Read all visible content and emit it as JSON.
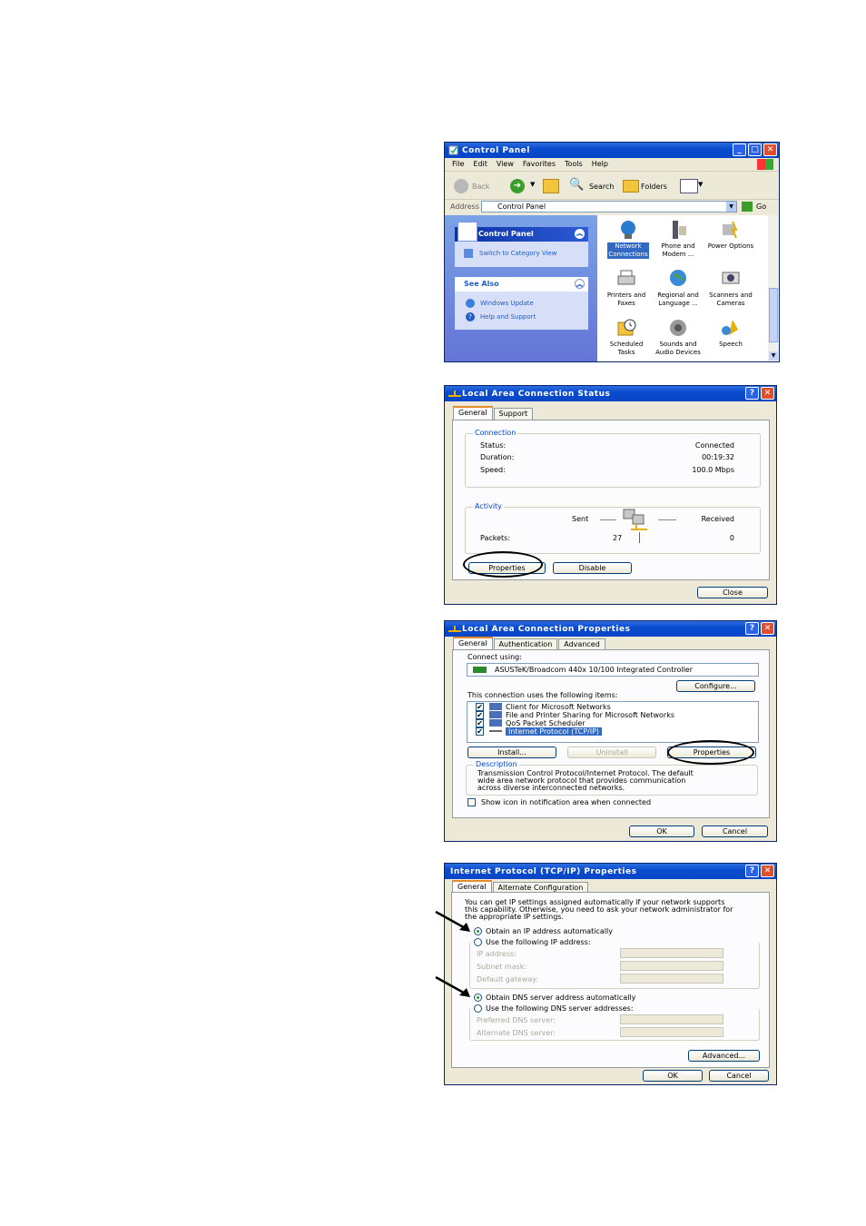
{
  "control_panel": {
    "title": "Control Panel",
    "menu": [
      "File",
      "Edit",
      "View",
      "Favorites",
      "Tools",
      "Help"
    ],
    "toolbar": {
      "back": "Back",
      "search": "Search",
      "folders": "Folders"
    },
    "address_label": "Address",
    "address_value": "Control Panel",
    "go_label": "Go",
    "side_panel_title": "Control Panel",
    "switch_view": "Switch to Category View",
    "see_also_title": "See Also",
    "see_also_items": [
      "Windows Update",
      "Help and Support"
    ],
    "icons": [
      {
        "l1": "Network",
        "l2": "Connections",
        "icon": "network-connections-icon"
      },
      {
        "l1": "Phone and",
        "l2": "Modem ...",
        "icon": "phone-modem-icon"
      },
      {
        "l1": "Power Options",
        "l2": "",
        "icon": "power-options-icon"
      },
      {
        "l1": "Printers and",
        "l2": "Faxes",
        "icon": "printers-faxes-icon"
      },
      {
        "l1": "Regional and",
        "l2": "Language ...",
        "icon": "regional-language-icon"
      },
      {
        "l1": "Scanners and",
        "l2": "Cameras",
        "icon": "scanners-cameras-icon"
      },
      {
        "l1": "Scheduled",
        "l2": "Tasks",
        "icon": "scheduled-tasks-icon"
      },
      {
        "l1": "Sounds and",
        "l2": "Audio Devices",
        "icon": "sounds-audio-icon"
      },
      {
        "l1": "Speech",
        "l2": "",
        "icon": "speech-icon"
      }
    ]
  },
  "lan_status": {
    "title": "Local Area Connection Status",
    "tabs": [
      "General",
      "Support"
    ],
    "connection_label": "Connection",
    "status_label": "Status:",
    "status_value": "Connected",
    "duration_label": "Duration:",
    "duration_value": "00:19:32",
    "speed_label": "Speed:",
    "speed_value": "100.0 Mbps",
    "activity_label": "Activity",
    "sent_label": "Sent",
    "received_label": "Received",
    "packets_label": "Packets:",
    "packets_sent": "27",
    "packets_received": "0",
    "properties_btn": "Properties",
    "disable_btn": "Disable",
    "close_btn": "Close"
  },
  "lan_props": {
    "title": "Local Area Connection Properties",
    "tabs": [
      "General",
      "Authentication",
      "Advanced"
    ],
    "connect_using_label": "Connect using:",
    "adapter": "ASUSTeK/Broadcom 440x 10/100 Integrated Controller",
    "configure_btn": "Configure...",
    "items_label": "This connection uses the following items:",
    "items": [
      "Client for Microsoft Networks",
      "File and Printer Sharing for Microsoft Networks",
      "QoS Packet Scheduler",
      "Internet Protocol (TCP/IP)"
    ],
    "install_btn": "Install...",
    "uninstall_btn": "Uninstall",
    "properties_btn": "Properties",
    "description_label": "Description",
    "description_lines": [
      "Transmission Control Protocol/Internet Protocol. The default",
      "wide area network protocol that provides communication",
      "across diverse interconnected networks."
    ],
    "show_icon_label": "Show icon in notification area when connected",
    "ok_btn": "OK",
    "cancel_btn": "Cancel"
  },
  "tcpip": {
    "title": "Internet Protocol (TCP/IP) Properties",
    "tabs": [
      "General",
      "Alternate Configuration"
    ],
    "intro_lines": [
      "You can get IP settings assigned automatically if your network supports",
      "this capability. Otherwise, you need to ask your network administrator for",
      "the appropriate IP settings."
    ],
    "obtain_ip": "Obtain an IP address automatically",
    "use_ip": "Use the following IP address:",
    "ip_address": "IP address:",
    "subnet_mask": "Subnet mask:",
    "default_gateway": "Default gateway:",
    "obtain_dns": "Obtain DNS server address automatically",
    "use_dns": "Use the following DNS server addresses:",
    "preferred_dns": "Preferred DNS server:",
    "alternate_dns": "Alternate DNS server:",
    "advanced_btn": "Advanced...",
    "ok_btn": "OK",
    "cancel_btn": "Cancel"
  },
  "colors": {
    "title_blue": "#0a4ccf",
    "xp_face": "#ece9d8",
    "link_blue": "#0046d5",
    "select_blue": "#316ac5"
  }
}
